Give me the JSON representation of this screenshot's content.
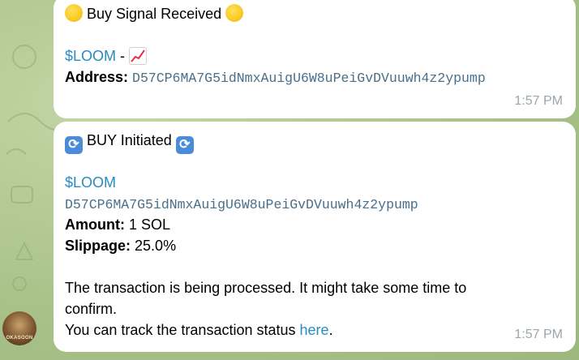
{
  "message1": {
    "header_text": "Buy Signal Received",
    "token": "$LOOM",
    "separator": "-",
    "address_label": "Address:",
    "address": "D57CP6MA7G5idNmxAuigU6W8uPeiGvDVuuwh4z2ypump",
    "time": "1:57 PM",
    "icons": [
      "yellow-circle-icon",
      "chart-increasing-icon"
    ]
  },
  "message2": {
    "header_text": "BUY Initiated",
    "token": "$LOOM",
    "address": "D57CP6MA7G5idNmxAuigU6W8uPeiGvDVuuwh4z2ypump",
    "amount_label": "Amount:",
    "amount_value": "1 SOL",
    "slippage_label": "Slippage:",
    "slippage_value": "25.0%",
    "processing_text": "The transaction is being processed. It might take some time to",
    "processing_text_2": "confirm.",
    "track_text": "You can track the transaction status",
    "track_link": "here",
    "track_end": ".",
    "time": "1:57 PM",
    "icons": [
      "refresh-arrows-icon"
    ]
  },
  "avatar": {
    "label": "OKASOON"
  },
  "colors": {
    "bubble": "#ffffff",
    "link": "#2a8ac2",
    "timestamp": "#9aa6ad",
    "background": "#a9c28a"
  }
}
